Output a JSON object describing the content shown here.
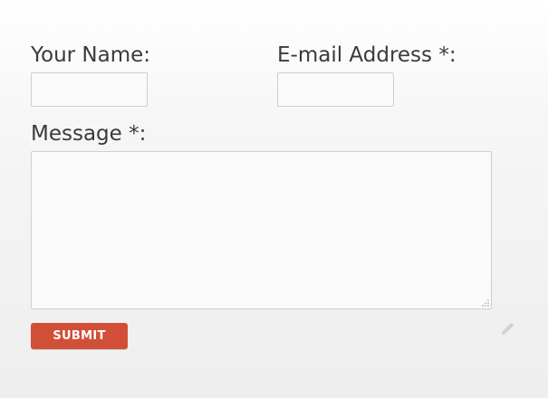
{
  "form": {
    "name_label": "Your Name:",
    "email_label": "E-mail Address *:",
    "message_label": "Message *:",
    "name_value": "",
    "email_value": "",
    "message_value": "",
    "submit_label": "SUBMIT"
  },
  "icons": {
    "resize": "resize-grip-icon",
    "edit": "pencil-icon"
  },
  "colors": {
    "submit_background": "#d24f37",
    "submit_text": "#ffffff",
    "label_text": "#3a3a3a",
    "field_border": "#cfcfcf"
  }
}
